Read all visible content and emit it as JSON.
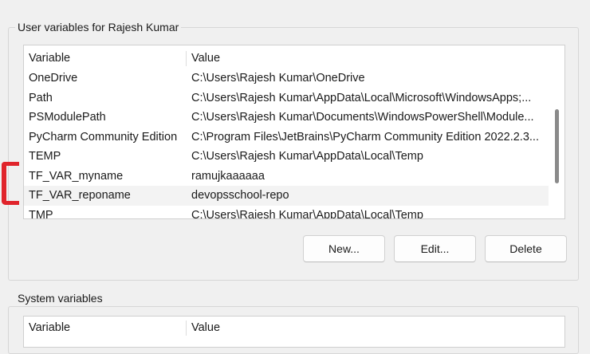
{
  "user_section": {
    "title": "User variables for Rajesh Kumar",
    "columns": {
      "variable": "Variable",
      "value": "Value"
    },
    "rows": [
      {
        "name": "OneDrive",
        "value": "C:\\Users\\Rajesh Kumar\\OneDrive"
      },
      {
        "name": "Path",
        "value": "C:\\Users\\Rajesh Kumar\\AppData\\Local\\Microsoft\\WindowsApps;..."
      },
      {
        "name": "PSModulePath",
        "value": "C:\\Users\\Rajesh Kumar\\Documents\\WindowsPowerShell\\Module..."
      },
      {
        "name": "PyCharm Community Edition",
        "value": "C:\\Program Files\\JetBrains\\PyCharm Community Edition 2022.2.3..."
      },
      {
        "name": "TEMP",
        "value": "C:\\Users\\Rajesh Kumar\\AppData\\Local\\Temp"
      },
      {
        "name": "TF_VAR_myname",
        "value": "ramujkaaaaaa"
      },
      {
        "name": "TF_VAR_reponame",
        "value": "devopsschool-repo"
      },
      {
        "name": "TMP",
        "value": "C:\\Users\\Rajesh Kumar\\AppData\\Local\\Temp"
      }
    ],
    "buttons": {
      "new": "New...",
      "edit": "Edit...",
      "delete": "Delete"
    }
  },
  "system_section": {
    "title": "System variables",
    "columns": {
      "variable": "Variable",
      "value": "Value"
    }
  },
  "colors": {
    "annotation": "#e0242b",
    "selected_row": "#f3f3f3",
    "background": "#f0f0f0"
  }
}
